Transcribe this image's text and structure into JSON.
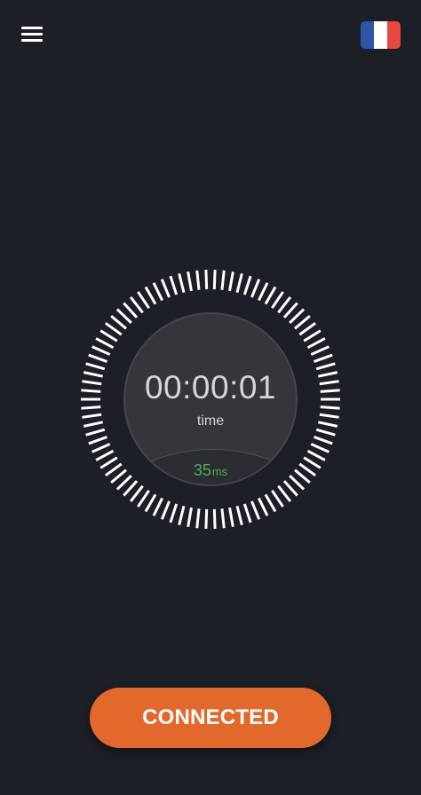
{
  "header": {
    "menu_icon": "hamburger-menu-icon",
    "server_flag": {
      "country": "France",
      "icon": "france-flag-icon",
      "colors": [
        "#2f56a6",
        "#ffffff",
        "#e8473f"
      ]
    }
  },
  "status": {
    "timer": "00:00:01",
    "timer_label": "time",
    "ping_value": "35",
    "ping_unit": "ms",
    "ping_color": "#4caf50"
  },
  "connect_button": {
    "label": "CONNECTED",
    "color": "#e2692b"
  }
}
